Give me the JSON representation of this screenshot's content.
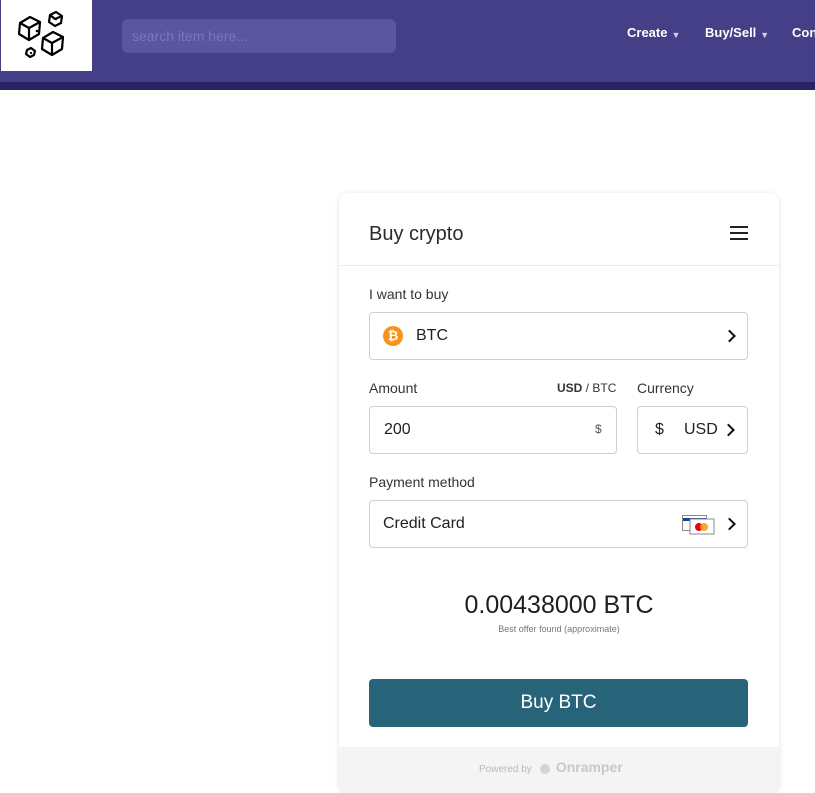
{
  "header": {
    "search_placeholder": "search item here...",
    "nav": [
      {
        "label": "Create",
        "has_dropdown": true
      },
      {
        "label": "Buy/Sell",
        "has_dropdown": true
      },
      {
        "label": "Con",
        "has_dropdown": false
      }
    ],
    "colors": {
      "header_bg": "#443f86",
      "underbar": "#2a2266"
    }
  },
  "widget": {
    "title": "Buy crypto",
    "want_to_buy_label": "I want to buy",
    "asset": {
      "symbol_glyph": "₿",
      "code": "BTC",
      "icon": "bitcoin-icon"
    },
    "amount_label": "Amount",
    "unit_toggle": {
      "active": "USD",
      "separator": " / ",
      "other": "BTC"
    },
    "amount_value": "200",
    "amount_suffix": "$",
    "currency_label": "Currency",
    "currency": {
      "symbol": "$",
      "code": "USD"
    },
    "payment_label": "Payment method",
    "payment_method": {
      "name": "Credit Card",
      "icon": "credit-card-icon"
    },
    "result_value": "0.00438000 BTC",
    "result_note": "Best offer found (approximate)",
    "buy_button": "Buy BTC",
    "footer": {
      "powered_by": "Powered by",
      "brand": "Onramper"
    },
    "colors": {
      "button": "#27647a",
      "bitcoin": "#f7931a"
    }
  }
}
